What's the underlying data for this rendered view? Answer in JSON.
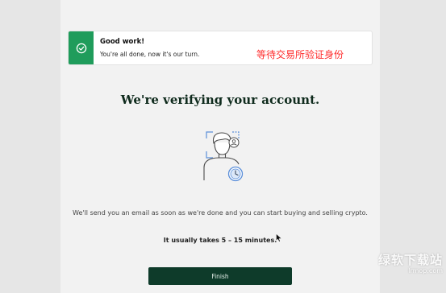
{
  "toast": {
    "title": "Good work!",
    "message": "You're all done, now it's our turn.",
    "icon": "check-circle-icon",
    "accent": "#1f9c5b"
  },
  "annotation": "等待交易所验证身份",
  "headline": "We're verifying your account.",
  "illustration": {
    "icon": "face-verification-icon"
  },
  "body_text": "We'll send you an email as soon as we're done and you can start buying and selling crypto.",
  "eta_text": "It usually takes 5 – 15 minutes.",
  "finish_button": {
    "label": "Finish",
    "color": "#0e3b2a"
  },
  "watermark": {
    "main": "绿软下载站",
    "url": "lrmop.com"
  }
}
